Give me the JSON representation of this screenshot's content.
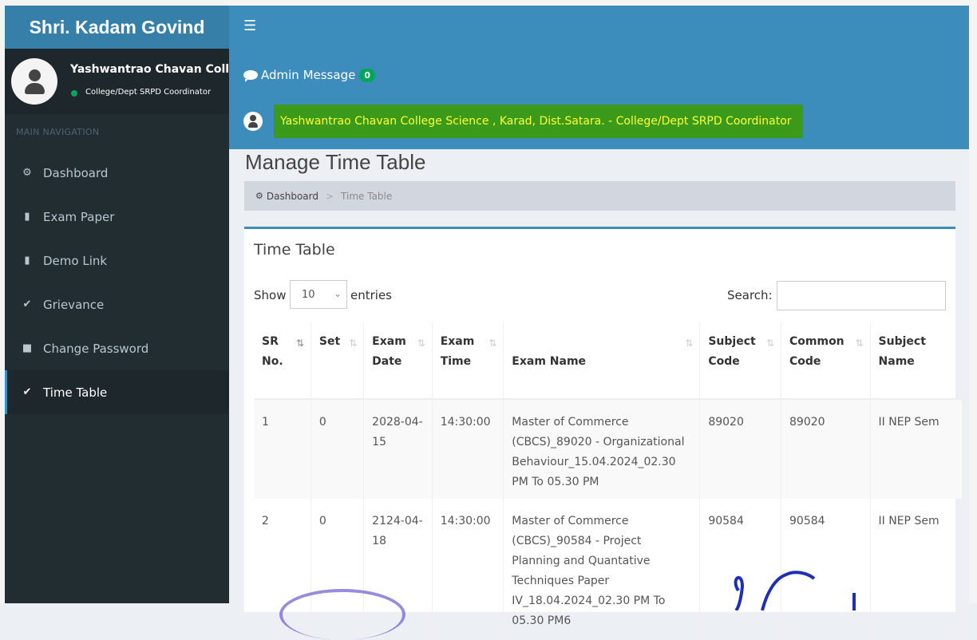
{
  "app": {
    "title": "Shri. Kadam Govind"
  },
  "header": {
    "menu_icon": "hamburger-icon",
    "admin_message_label": "Admin Message",
    "admin_message_count": "0",
    "user_banner": "Yashwantrao Chavan College Science , Karad, Dist.Satara. - College/Dept SRPD Coordinator"
  },
  "sidebar": {
    "user_name": "Yashwantrao Chavan College",
    "user_role": "College/Dept SRPD Coordinator",
    "nav_header": "MAIN NAVIGATION",
    "items": [
      {
        "label": "Dashboard",
        "icon": "dashboard-icon"
      },
      {
        "label": "Exam Paper",
        "icon": "file-icon"
      },
      {
        "label": "Demo Link",
        "icon": "file-icon"
      },
      {
        "label": "Grievance",
        "icon": "check-icon"
      },
      {
        "label": "Change Password",
        "icon": "lock-icon"
      },
      {
        "label": "Time Table",
        "icon": "check-icon"
      }
    ]
  },
  "main": {
    "page_title": "Manage Time Table",
    "breadcrumb": {
      "home": "Dashboard",
      "separator": ">",
      "current": "Time Table"
    },
    "box_title": "Time Table",
    "show_label": "Show",
    "entries_value": "10",
    "entries_label": "entries",
    "search_label": "Search:",
    "columns": [
      "SR No.",
      "Set",
      "Exam Date",
      "Exam Time",
      "Exam Name",
      "Subject Code",
      "Common Code",
      "Subject Name"
    ],
    "rows": [
      {
        "sr": "1",
        "set": "0",
        "date": "2028-04-15",
        "time": "14:30:00",
        "name": "Master of Commerce (CBCS)_89020 - Organizational Behaviour_15.04.2024_02.30 PM To 05.30 PM",
        "subject_code": "89020",
        "common_code": "89020",
        "subject_name": "II NEP Sem"
      },
      {
        "sr": "2",
        "set": "0",
        "date": "2124-04-18",
        "time": "14:30:00",
        "name": "Master of Commerce (CBCS)_90584 - Project Planning and Quantative Techniques Paper IV_18.04.2024_02.30 PM To 05.30 PM6",
        "subject_code": "90584",
        "common_code": "90584",
        "subject_name": "II NEP Sem"
      }
    ]
  },
  "colors": {
    "header": "#3c8dbc",
    "logo": "#367fa9",
    "sidebar": "#222d32",
    "banner": "#3c9a1a",
    "banner_text": "#ffff33",
    "badge": "#00a65a"
  }
}
